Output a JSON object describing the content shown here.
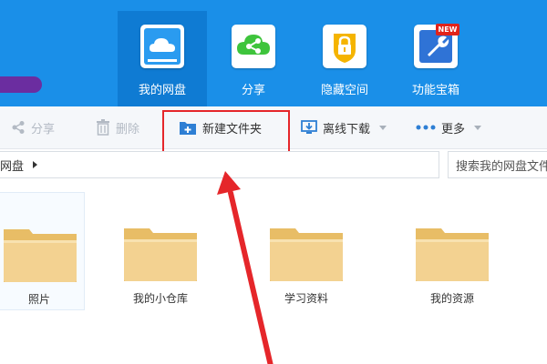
{
  "nav": {
    "items": [
      {
        "label": "我的网盘",
        "icon": "cloud-icon"
      },
      {
        "label": "分享",
        "icon": "share-icon"
      },
      {
        "label": "隐藏空间",
        "icon": "lock-icon"
      },
      {
        "label": "功能宝箱",
        "icon": "toolbox-icon",
        "badge": "NEW"
      }
    ]
  },
  "toolbar": {
    "share_label": "分享",
    "delete_label": "删除",
    "new_folder_label": "新建文件夹",
    "offline_download_label": "离线下载",
    "more_label": "更多"
  },
  "breadcrumb": {
    "current": "网盘"
  },
  "search": {
    "placeholder": "搜索我的网盘文件"
  },
  "folders": [
    {
      "name": "照片"
    },
    {
      "name": "我的小仓库"
    },
    {
      "name": "学习资料"
    },
    {
      "name": "我的资源"
    }
  ],
  "colors": {
    "header_blue": "#1a8fe8",
    "active_blue": "#0f7bd3",
    "highlight_red": "#e5262a",
    "folder_tan": "#f3d291"
  }
}
